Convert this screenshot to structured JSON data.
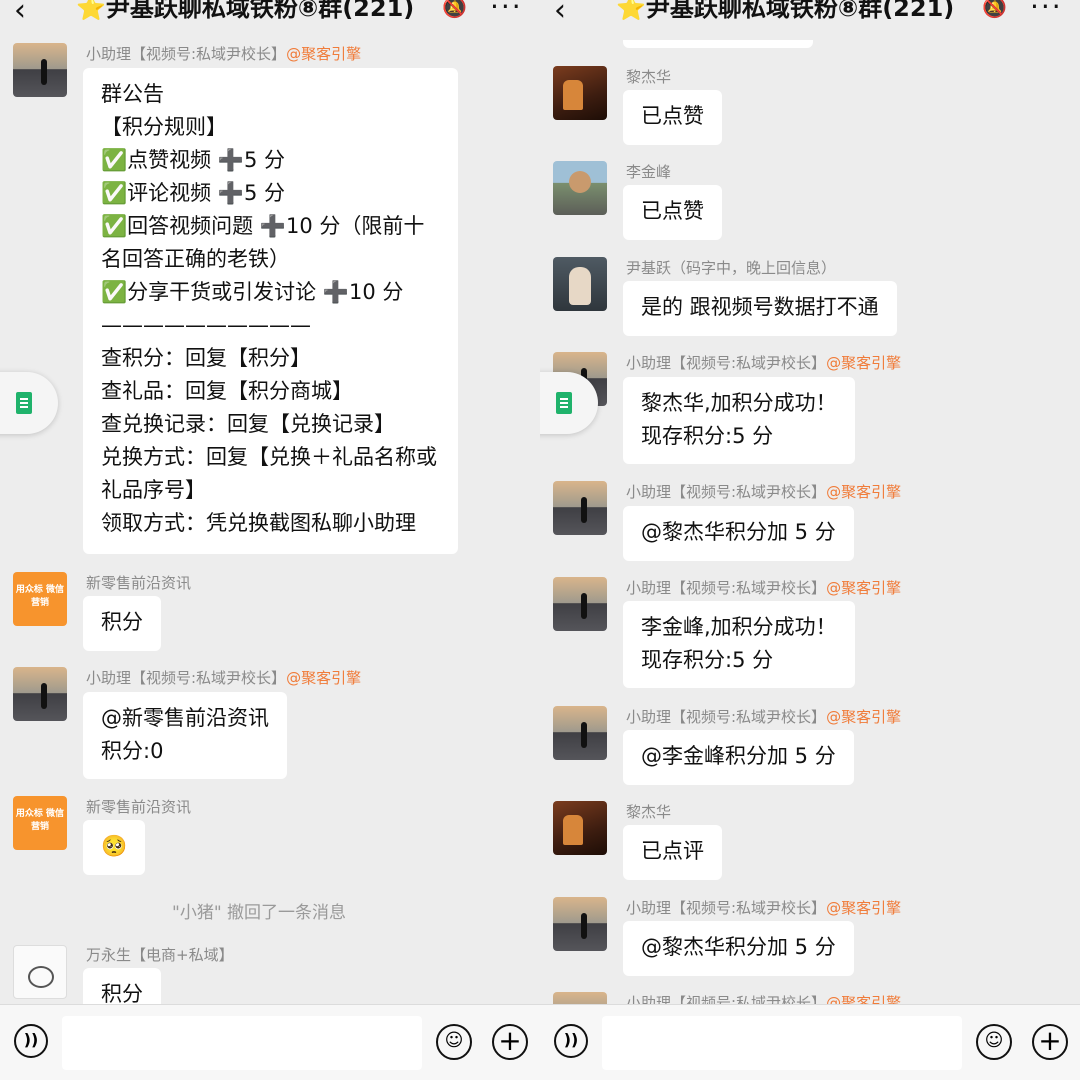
{
  "header": {
    "back_glyph": "‹",
    "title": "⭐尹基跃聊私域铁粉⑧群(221)",
    "mute_icon": "bell-muted-icon",
    "more_glyph": "···"
  },
  "bottom": {
    "voice_glyph": "))",
    "emoji_glyph": "☺",
    "plus_glyph": "+"
  },
  "left": {
    "messages": [
      {
        "sender": "小助理【视频号:私域尹校长】",
        "tag": "@聚客引擎",
        "text": "群公告\n【积分规则】\n✅点赞视频 ➕5 分\n✅评论视频 ➕5 分\n✅回答视频问题 ➕10 分（限前十名回答正确的老铁）\n✅分享干货或引发讨论 ➕10 分\n——————————\n查积分：回复【积分】\n查礼品：回复【积分商城】\n查兑换记录：回复【兑换记录】\n兑换方式：回复【兑换＋礼品名称或礼品序号】\n领取方式：凭兑换截图私聊小助理"
      },
      {
        "sender": "新零售前沿资讯",
        "tag": "",
        "text": "积分",
        "avatar_text": "用众标\n微信营销"
      },
      {
        "sender": "小助理【视频号:私域尹校长】",
        "tag": "@聚客引擎",
        "text": "@新零售前沿资讯\n积分:0"
      },
      {
        "sender": "新零售前沿资讯",
        "tag": "",
        "text": "🥺",
        "avatar_text": "用众标\n微信营销"
      },
      {
        "sender": "万永生【电商+私域】",
        "tag": "",
        "text": "积分"
      }
    ],
    "recall_notice": "\"小猪\" 撤回了一条消息"
  },
  "right": {
    "messages": [
      {
        "sender": "黎杰华",
        "tag": "",
        "text": "已点赞"
      },
      {
        "sender": "李金峰",
        "tag": "",
        "text": "已点赞"
      },
      {
        "sender": "尹基跃（码字中，晚上回信息）",
        "tag": "",
        "text": "是的 跟视频号数据打不通"
      },
      {
        "sender": "小助理【视频号:私域尹校长】",
        "tag": "@聚客引擎",
        "text": "黎杰华,加积分成功！\n现存积分:5 分"
      },
      {
        "sender": "小助理【视频号:私域尹校长】",
        "tag": "@聚客引擎",
        "text": "@黎杰华积分加 5 分"
      },
      {
        "sender": "小助理【视频号:私域尹校长】",
        "tag": "@聚客引擎",
        "text": "李金峰,加积分成功！\n现存积分:5 分"
      },
      {
        "sender": "小助理【视频号:私域尹校长】",
        "tag": "@聚客引擎",
        "text": "@李金峰积分加 5 分"
      },
      {
        "sender": "黎杰华",
        "tag": "",
        "text": "已点评"
      },
      {
        "sender": "小助理【视频号:私域尹校长】",
        "tag": "@聚客引擎",
        "text": "@黎杰华积分加 5 分"
      },
      {
        "sender": "小助理【视频号:私域尹校长】",
        "tag": "@聚客引擎",
        "text": ""
      }
    ]
  }
}
